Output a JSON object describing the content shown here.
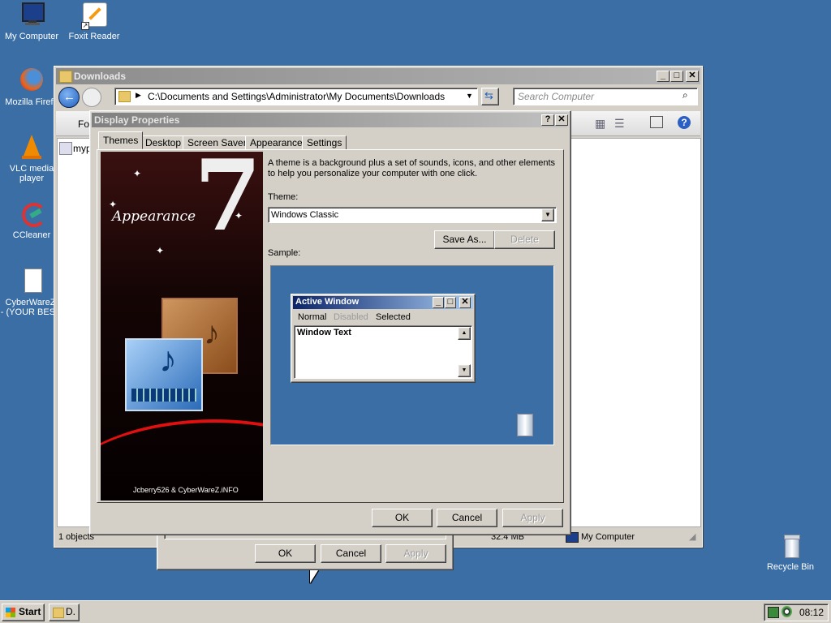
{
  "desktop": {
    "icons": [
      {
        "label": "My Computer"
      },
      {
        "label": "Foxit Reader"
      },
      {
        "label": "Mozilla Firefo"
      },
      {
        "label": "VLC media"
      },
      {
        "label": "player"
      },
      {
        "label": "CCleaner"
      },
      {
        "label": "CyberWareZ."
      },
      {
        "label": "- (YOUR BES..."
      },
      {
        "label": "Recycle Bin"
      }
    ]
  },
  "explorer": {
    "title": "Downloads",
    "address": "C:\\Documents and Settings\\Administrator\\My Documents\\Downloads",
    "search_placeholder": "Search Computer",
    "toolbar_partial": "Fol",
    "file_partial": "myp",
    "status_objects": "1 objects",
    "status_size": "32.4 MB",
    "status_location": "My Computer"
  },
  "back_dialog": {
    "ok": "OK",
    "cancel": "Cancel",
    "apply": "Apply"
  },
  "display_properties": {
    "title": "Display Properties",
    "help_btn": "?",
    "close_btn": "✕",
    "tabs": [
      {
        "label": "Themes"
      },
      {
        "label": "Desktop"
      },
      {
        "label": "Screen Saver"
      },
      {
        "label": "Appearance"
      },
      {
        "label": "Settings"
      }
    ],
    "banner_title": "Appearance",
    "banner_number": "7",
    "banner_credit": "Jcberry526 & CyberWareZ.iNFO",
    "description": "A theme is a background plus a set of sounds, icons, and other elements to help you personalize your computer with one click.",
    "theme_label": "Theme:",
    "theme_value": "Windows Classic",
    "save_as": "Save As...",
    "delete": "Delete",
    "sample_label": "Sample:",
    "sample": {
      "window_title": "Active Window",
      "menu_normal": "Normal",
      "menu_disabled": "Disabled",
      "menu_selected": "Selected",
      "window_text": "Window Text"
    },
    "ok": "OK",
    "cancel": "Cancel",
    "apply": "Apply"
  },
  "taskbar": {
    "start": "Start",
    "task_label": "D.",
    "clock": "08:12"
  }
}
